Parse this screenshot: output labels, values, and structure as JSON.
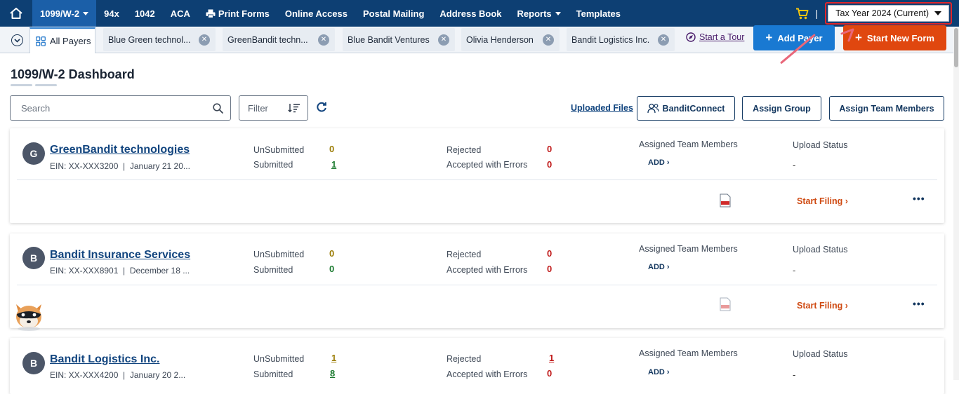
{
  "nav": {
    "product": "1099/W-2",
    "items": [
      "94x",
      "1042",
      "ACA",
      "Print Forms",
      "Online Access",
      "Postal Mailing",
      "Address Book",
      "Reports",
      "Templates"
    ],
    "tax_year": "Tax Year 2024 (Current)"
  },
  "tabs": {
    "all_payers": "All Payers",
    "payers": [
      "Blue Green technol...",
      "GreenBandit techn...",
      "Blue Bandit Ventures",
      "Olivia Henderson",
      "Bandit Logistics Inc."
    ],
    "start_tour": "Start a Tour",
    "add_payer": "Add Payer",
    "start_new_form": "Start New Form"
  },
  "dashboard": {
    "title": "1099/W-2 Dashboard",
    "search_placeholder": "Search",
    "filter_label": "Filter",
    "uploaded_files": "Uploaded Files",
    "bandit_connect": "BanditConnect",
    "assign_group": "Assign Group",
    "assign_team_members": "Assign Team Members"
  },
  "labels": {
    "unsubmitted": "UnSubmitted",
    "submitted": "Submitted",
    "rejected": "Rejected",
    "accepted_with_errors": "Accepted with Errors",
    "assigned_team_members": "Assigned Team Members",
    "upload_status": "Upload Status",
    "add": "ADD",
    "start_filing": "Start Filing",
    "dash": "-"
  },
  "payers": [
    {
      "initial": "G",
      "name": "GreenBandit technologies",
      "ein": "EIN: XX-XXX3200",
      "date": "January 21 20...",
      "unsubmitted": "0",
      "submitted": "1",
      "rejected": "0",
      "accepted_errors": "0"
    },
    {
      "initial": "B",
      "name": "Bandit Insurance Services",
      "ein": "EIN: XX-XXX8901",
      "date": "December 18 ...",
      "unsubmitted": "0",
      "submitted": "0",
      "rejected": "0",
      "accepted_errors": "0"
    },
    {
      "initial": "B",
      "name": "Bandit Logistics Inc.",
      "ein": "EIN: XX-XXX4200",
      "date": "January 20 2...",
      "unsubmitted": "1",
      "submitted": "8",
      "rejected": "1",
      "accepted_errors": "0"
    }
  ],
  "colors": {
    "nav_bg": "#0d3f73",
    "accent_blue": "#1979d2",
    "accent_orange": "#e0470f",
    "highlight_red": "#e0262b"
  },
  "icons": [
    "home-icon",
    "cart-icon",
    "printer-icon",
    "grid-icon",
    "tour-icon",
    "search-icon",
    "sort-icon",
    "refresh-icon",
    "team-icon",
    "pdf-icon",
    "more-icon"
  ]
}
